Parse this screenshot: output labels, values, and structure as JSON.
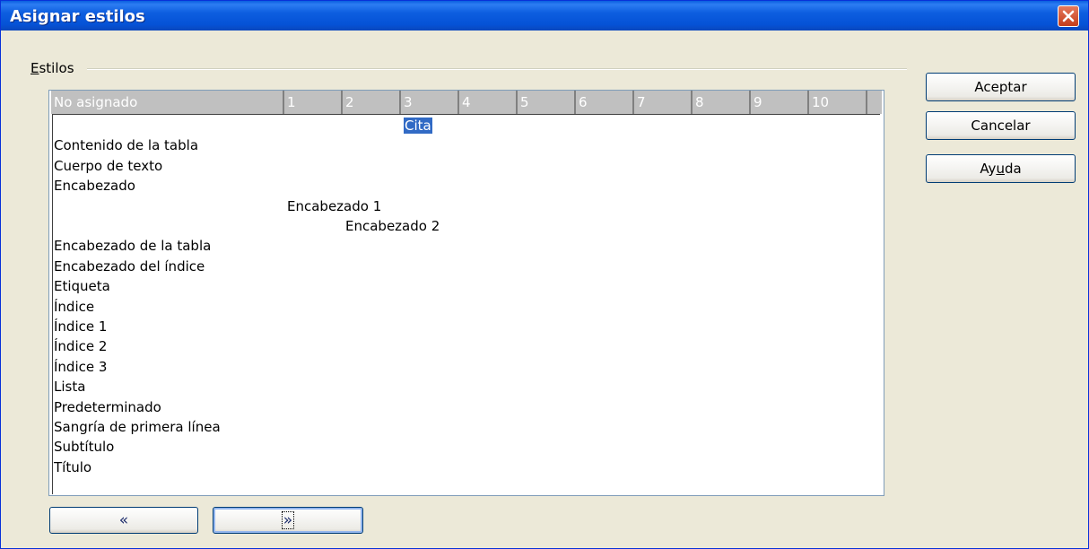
{
  "window": {
    "title": "Asignar estilos",
    "titlebar_color": "#0552d6",
    "close_icon": "close-icon"
  },
  "group": {
    "label": "Estilos"
  },
  "columns": [
    "No asignado",
    "1",
    "2",
    "3",
    "4",
    "5",
    "6",
    "7",
    "8",
    "9",
    "10"
  ],
  "styles": [
    {
      "name": "Cita",
      "level": "3",
      "selected": true
    },
    {
      "name": "Contenido de la tabla",
      "level": "No asignado"
    },
    {
      "name": "Cuerpo de texto",
      "level": "No asignado"
    },
    {
      "name": "Encabezado",
      "level": "No asignado"
    },
    {
      "name": "Encabezado 1",
      "level": "1"
    },
    {
      "name": "Encabezado 2",
      "level": "2"
    },
    {
      "name": "Encabezado de la tabla",
      "level": "No asignado"
    },
    {
      "name": "Encabezado del índice",
      "level": "No asignado"
    },
    {
      "name": "Etiqueta",
      "level": "No asignado"
    },
    {
      "name": "Índice",
      "level": "No asignado"
    },
    {
      "name": "Índice 1",
      "level": "No asignado"
    },
    {
      "name": "Índice 2",
      "level": "No asignado"
    },
    {
      "name": "Índice 3",
      "level": "No asignado"
    },
    {
      "name": "Lista",
      "level": "No asignado"
    },
    {
      "name": "Predeterminado",
      "level": "No asignado"
    },
    {
      "name": "Sangría de primera línea",
      "level": "No asignado"
    },
    {
      "name": "Subtítulo",
      "level": "No asignado"
    },
    {
      "name": "Título",
      "level": "No asignado"
    }
  ],
  "buttons": {
    "ok": "Aceptar",
    "cancel": "Cancelar",
    "help_pre": "Ay",
    "help_accel": "u",
    "help_post": "da",
    "left": "«",
    "right": "»"
  },
  "selection_color": "#316ac5"
}
